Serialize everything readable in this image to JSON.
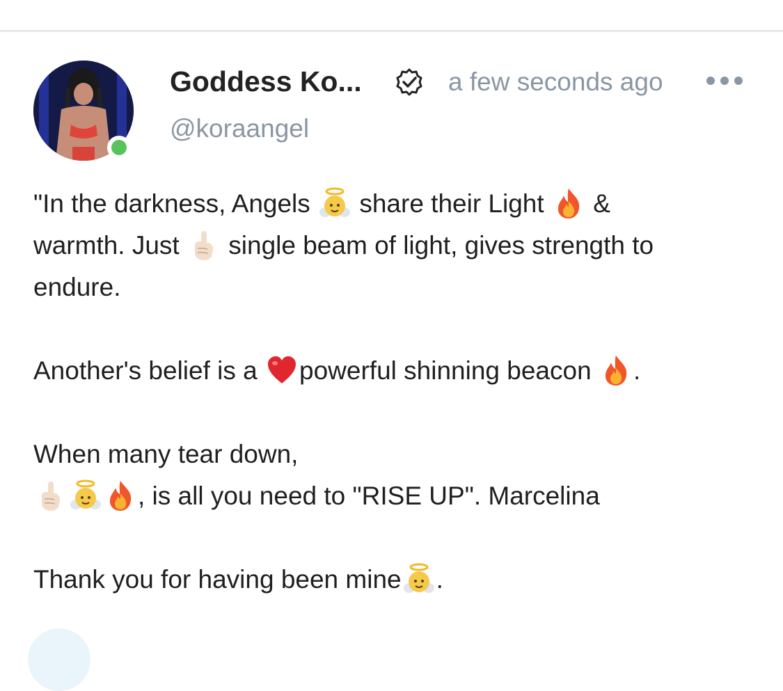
{
  "post": {
    "author": {
      "name": "Goddess Ko...",
      "handle": "@koraangel",
      "online": true,
      "verified": true
    },
    "timestamp": "a few seconds ago",
    "menu_icon": "more-dots-icon",
    "body": {
      "p1": {
        "t1": "\"In the darkness, Angels ",
        "t2": " share their Light ",
        "t3": " &\nwarmth. Just ",
        "t4": " single beam of light, gives strength to\nendure."
      },
      "p2": {
        "t1": "Another's belief is a ",
        "t2": "powerful shinning beacon ",
        "t3": "."
      },
      "p3": {
        "t1": "When many tear down,",
        "t2": ", is all you need to \"RISE UP\". Marcelina"
      },
      "p4": {
        "t1": "Thank you for having been mine",
        "t2": "."
      }
    },
    "emojis": {
      "angel": "angel-emoji",
      "fire": "fire-emoji",
      "point_up": "point-up-emoji",
      "heart": "red-heart-emoji"
    },
    "colors": {
      "muted": "#8a96a3",
      "online": "#58c35a",
      "divider": "#e6e8ec"
    }
  }
}
